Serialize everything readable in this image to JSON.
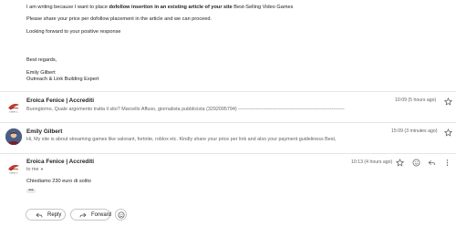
{
  "quoted": {
    "line1_pre": "I am writing because I want to place ",
    "line1_bold": "dofollow insertion in an existing article of your site",
    "line1_post": " Best-Selling Video Games",
    "line2": "Please share your price per dofollow placement in the article and we can proceed.",
    "line3": "Looking forward to your positive response",
    "regards": "Best regards,",
    "name": "Emily Gilbert",
    "role": "Outreach & Link Building Expert"
  },
  "messages": [
    {
      "sender": "Eroica Fenice | Accrediti",
      "snippet": "Buongiorno, Quale argomento tratta il sito? Marcello Affuso, giornalista pubblicista (3292095794) ----------------------------------------------------------------- E",
      "time": "10:09 (5 hours ago)"
    },
    {
      "sender": "Emily Gilbert",
      "snippet": "Hi, My site is about streaming games like valorant, fortnite, roblox etc. Kindly share your price per link and also your payment guideliness Best,",
      "time": "15:09 (3 minutes ago)"
    },
    {
      "sender": "Eroica Fenice | Accrediti",
      "to": "to me",
      "body": "Chiediamo 230 euro di solito",
      "time": "10:13 (4 hours ago)"
    }
  ],
  "actions": {
    "reply": "Reply",
    "forward": "Forward"
  },
  "icons": {
    "star": "star-icon",
    "emoji": "emoji-icon",
    "reply": "reply-icon",
    "more": "more-vert-icon",
    "forward": "forward-icon"
  },
  "colors": {
    "logo_red": "#c0392b"
  }
}
